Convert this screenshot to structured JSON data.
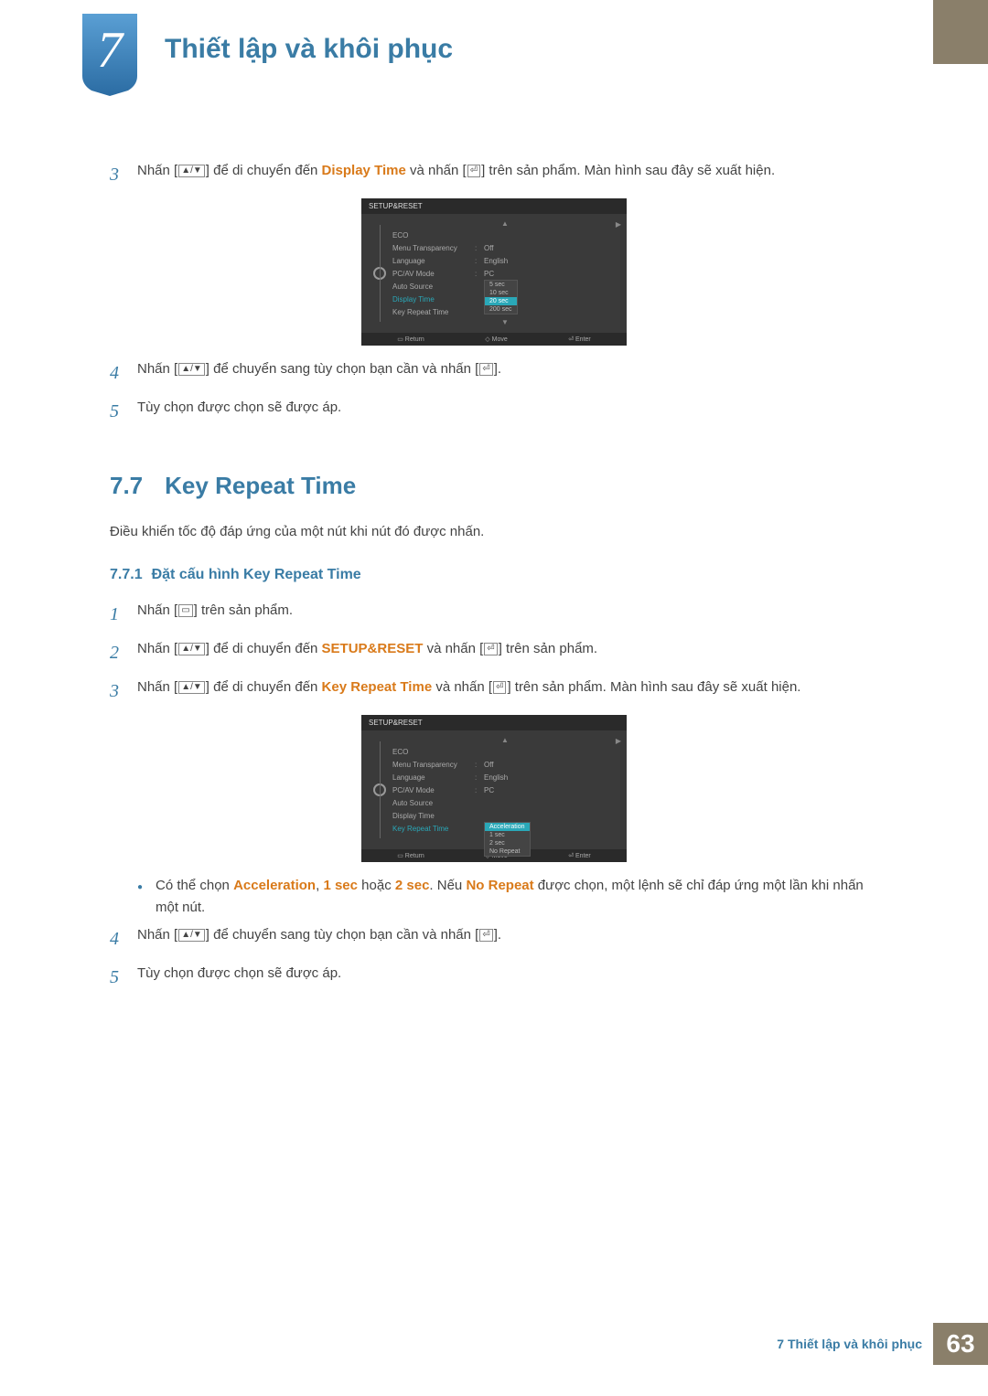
{
  "chapter": {
    "number": "7",
    "title": "Thiết lập và khôi phục"
  },
  "steps_top": {
    "s3_pre": "Nhấn [",
    "s3_mid1": "] để di chuyển đến ",
    "s3_hl": "Display Time",
    "s3_mid2": " và nhấn [",
    "s3_post": "] trên sản phẩm. Màn hình sau đây sẽ xuất hiện.",
    "s4_pre": "Nhấn [",
    "s4_mid": "] để chuyển sang tùy chọn bạn cần và nhấn [",
    "s4_post": "].",
    "s5": "Tùy chọn được chọn sẽ được áp."
  },
  "osd1": {
    "title": "SETUP&RESET",
    "items": [
      {
        "label": "ECO"
      },
      {
        "label": "Menu Transparency",
        "val": "Off"
      },
      {
        "label": "Language",
        "val": "English"
      },
      {
        "label": "PC/AV Mode",
        "val": "PC"
      },
      {
        "label": "Auto Source"
      },
      {
        "label": "Display Time",
        "active": true
      },
      {
        "label": "Key Repeat Time"
      }
    ],
    "popup": [
      "5 sec",
      "10 sec",
      "20 sec",
      "200 sec"
    ],
    "popup_sel": 2,
    "footer": {
      "return": "Return",
      "move": "Move",
      "enter": "Enter"
    }
  },
  "section": {
    "num": "7.7",
    "title": "Key Repeat Time",
    "intro": "Điều khiển tốc độ đáp ứng của một nút khi nút đó được nhấn."
  },
  "subsection": {
    "num": "7.7.1",
    "title": "Đặt cấu hình Key Repeat Time"
  },
  "steps_bottom": {
    "s1_pre": "Nhấn [",
    "s1_post": "] trên sản phẩm.",
    "s2_pre": "Nhấn [",
    "s2_mid1": "] để di chuyển đến ",
    "s2_hl": "SETUP&RESET",
    "s2_mid2": " và nhấn [",
    "s2_post": "] trên sản phẩm.",
    "s3_pre": "Nhấn [",
    "s3_mid1": "] để di chuyển đến ",
    "s3_hl": "Key Repeat Time",
    "s3_mid2": " và nhấn [",
    "s3_post": "] trên sản phẩm. Màn hình sau đây sẽ xuất hiện.",
    "bullet_pre": "Có thể chọn ",
    "bullet_h1": "Acceleration",
    "bullet_c1": ", ",
    "bullet_h2": "1 sec",
    "bullet_c2": " hoặc ",
    "bullet_h3": "2 sec",
    "bullet_c3": ". Nếu ",
    "bullet_h4": "No Repeat",
    "bullet_post": " được chọn, một lệnh sẽ chỉ đáp ứng một lần khi nhấn một nút.",
    "s4_pre": "Nhấn [",
    "s4_mid": "] để chuyển sang tùy chọn bạn cần và nhấn [",
    "s4_post": "].",
    "s5": "Tùy chọn được chọn sẽ được áp."
  },
  "osd2": {
    "title": "SETUP&RESET",
    "items": [
      {
        "label": "ECO"
      },
      {
        "label": "Menu Transparency",
        "val": "Off"
      },
      {
        "label": "Language",
        "val": "English"
      },
      {
        "label": "PC/AV Mode",
        "val": "PC"
      },
      {
        "label": "Auto Source"
      },
      {
        "label": "Display Time"
      },
      {
        "label": "Key Repeat Time",
        "active": true
      }
    ],
    "popup": [
      "Acceleration",
      "1 sec",
      "2 sec",
      "No Repeat"
    ],
    "popup_sel": 0,
    "footer": {
      "return": "Return",
      "move": "Move",
      "enter": "Enter"
    }
  },
  "step_nums": {
    "n1": "1",
    "n2": "2",
    "n3": "3",
    "n4": "4",
    "n5": "5"
  },
  "page_footer": {
    "text": "7 Thiết lập và khôi phục",
    "page": "63"
  }
}
